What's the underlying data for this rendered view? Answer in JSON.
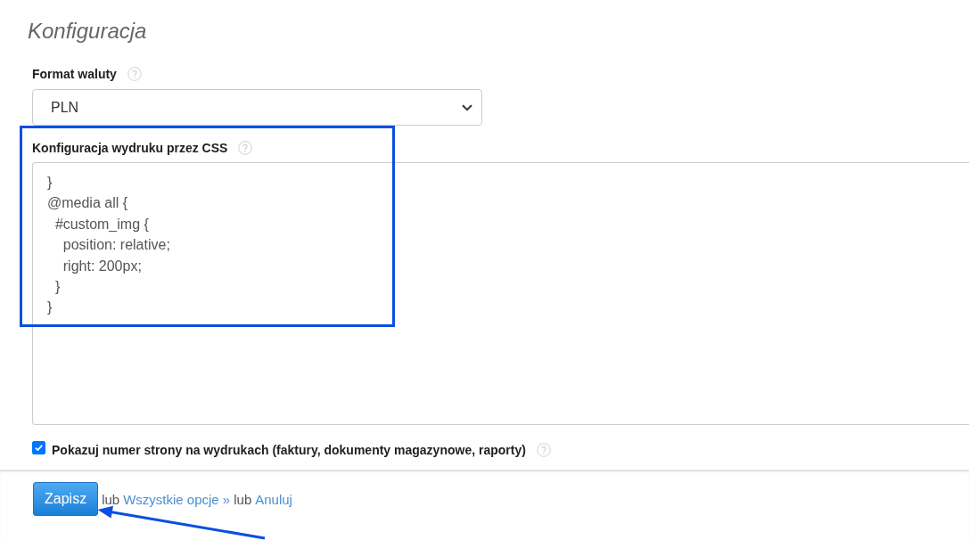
{
  "title": "Konfiguracja",
  "currency_format": {
    "label": "Format waluty",
    "value": "PLN"
  },
  "print_css": {
    "label": "Konfiguracja wydruku przez CSS",
    "value": "}\n@media all {\n  #custom_img {\n    position: relative;\n    right: 200px;\n  }\n}",
    "highlighted": true
  },
  "show_page_numbers": {
    "label": "Pokazuj numer strony na wydrukach (faktury, dokumenty magazynowe, raporty)",
    "checked": true
  },
  "footer": [
    {
      "kind": "button",
      "label": "Zapisz"
    },
    {
      "kind": "text",
      "label": "lub"
    },
    {
      "kind": "link",
      "label": "Wszystkie opcje »"
    },
    {
      "kind": "text",
      "label": "lub"
    },
    {
      "kind": "link",
      "label": "Anuluj"
    }
  ],
  "annotations": [
    {
      "kind": "arrow"
    }
  ]
}
